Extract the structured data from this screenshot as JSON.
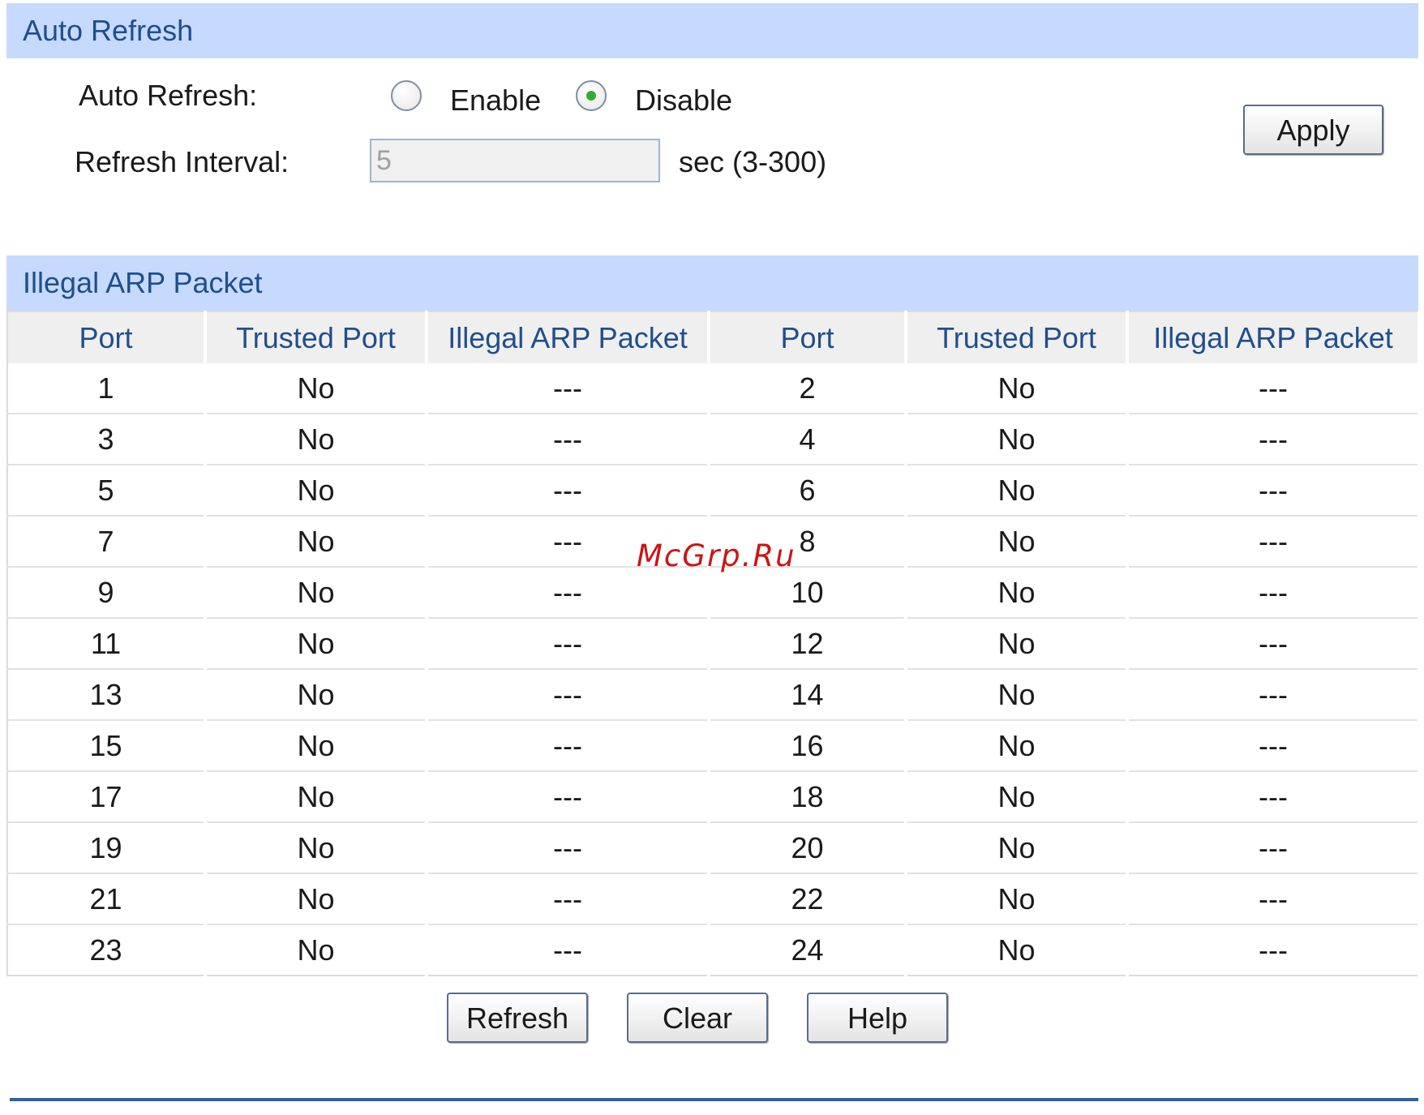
{
  "auto_refresh_section": {
    "title": "Auto Refresh",
    "auto_refresh_label": "Auto Refresh:",
    "enable_label": "Enable",
    "disable_label": "Disable",
    "selected": "Disable",
    "interval_label": "Refresh Interval:",
    "interval_value": "5",
    "interval_hint": "sec (3-300)",
    "apply_label": "Apply"
  },
  "arp_section": {
    "title": "Illegal ARP Packet",
    "columns": [
      "Port",
      "Trusted Port",
      "Illegal ARP Packet",
      "Port",
      "Trusted Port",
      "Illegal ARP Packet"
    ],
    "rows": [
      [
        "1",
        "No",
        "---",
        "2",
        "No",
        "---"
      ],
      [
        "3",
        "No",
        "---",
        "4",
        "No",
        "---"
      ],
      [
        "5",
        "No",
        "---",
        "6",
        "No",
        "---"
      ],
      [
        "7",
        "No",
        "---",
        "8",
        "No",
        "---"
      ],
      [
        "9",
        "No",
        "---",
        "10",
        "No",
        "---"
      ],
      [
        "11",
        "No",
        "---",
        "12",
        "No",
        "---"
      ],
      [
        "13",
        "No",
        "---",
        "14",
        "No",
        "---"
      ],
      [
        "15",
        "No",
        "---",
        "16",
        "No",
        "---"
      ],
      [
        "17",
        "No",
        "---",
        "18",
        "No",
        "---"
      ],
      [
        "19",
        "No",
        "---",
        "20",
        "No",
        "---"
      ],
      [
        "21",
        "No",
        "---",
        "22",
        "No",
        "---"
      ],
      [
        "23",
        "No",
        "---",
        "24",
        "No",
        "---"
      ]
    ]
  },
  "buttons": {
    "refresh": "Refresh",
    "clear": "Clear",
    "help": "Help"
  },
  "watermark": "McGrp.Ru",
  "colors": {
    "header_bg": "#c6d9ff",
    "header_text": "#1f4e8c",
    "radio_selected": "#2fae2f",
    "watermark": "#cc1414"
  }
}
